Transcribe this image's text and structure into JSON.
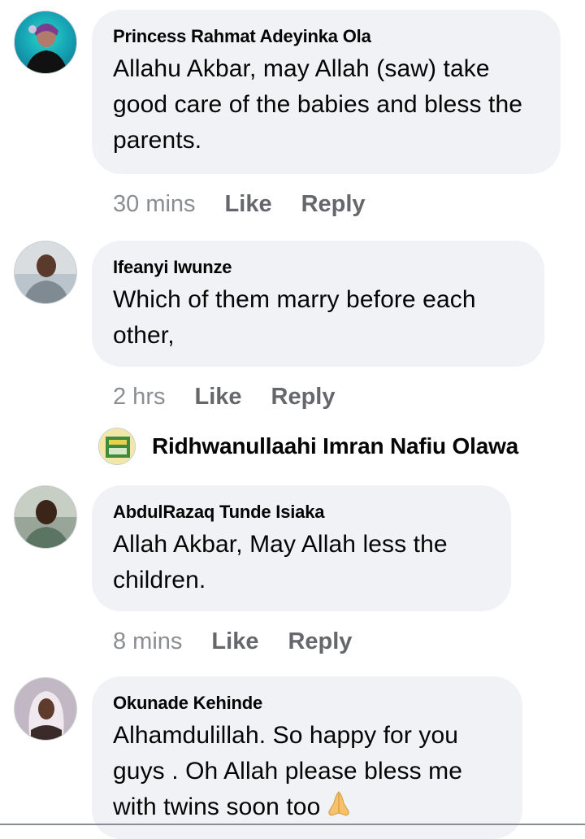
{
  "comments": [
    {
      "author": "Princess Rahmat Adeyinka Ola",
      "text": "Allahu Akbar, may Allah (saw) take good care of the babies and bless the parents.",
      "time": "30 mins",
      "like": "Like",
      "reply": "Reply"
    },
    {
      "author": "Ifeanyi Iwunze",
      "text": "Which of them marry before each other,",
      "time": "2 hrs",
      "like": "Like",
      "reply": "Reply"
    },
    {
      "author": "AbdulRazaq Tunde Isiaka",
      "text": "Allah Akbar, May Allah less the children.",
      "time": "8 mins",
      "like": "Like",
      "reply": "Reply"
    },
    {
      "author": "Okunade Kehinde",
      "text_line1": "Alhamdulillah. So happy for you",
      "text_line2": "guys . Oh Allah please bless me",
      "text_line3": "with twins soon too",
      "emoji": "folded-hands-icon"
    }
  ],
  "reply_preview": {
    "author": "Ridhwanullaahi Imran Nafiu Olawa"
  },
  "colors": {
    "bubble": "#f0f2f5",
    "secondary_text": "#65676b",
    "primary_text": "#050505"
  }
}
